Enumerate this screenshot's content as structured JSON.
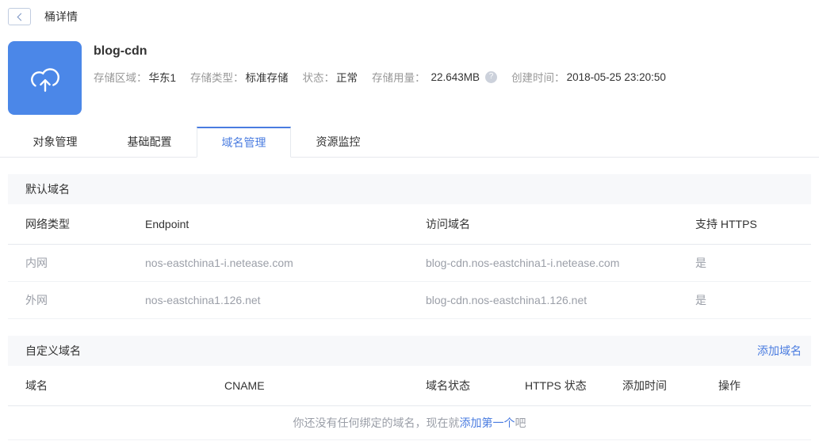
{
  "topbar": {
    "title": "桶详情"
  },
  "bucket": {
    "name": "blog-cdn",
    "meta": [
      {
        "label": "存储区域：",
        "value": "华东1"
      },
      {
        "label": "存储类型：",
        "value": "标准存储"
      },
      {
        "label": "状态：",
        "value": "正常"
      },
      {
        "label": "存储用量：",
        "value": "22.643MB"
      },
      {
        "label": "创建时间：",
        "value": "2018-05-25 23:20:50"
      }
    ]
  },
  "icons": {
    "help": "?"
  },
  "tabs": [
    {
      "label": "对象管理",
      "active": false
    },
    {
      "label": "基础配置",
      "active": false
    },
    {
      "label": "域名管理",
      "active": true
    },
    {
      "label": "资源监控",
      "active": false
    }
  ],
  "default_domain": {
    "section_title": "默认域名",
    "columns": [
      "网络类型",
      "Endpoint",
      "访问域名",
      "支持 HTTPS"
    ],
    "rows": [
      [
        "内网",
        "nos-eastchina1-i.netease.com",
        "blog-cdn.nos-eastchina1-i.netease.com",
        "是"
      ],
      [
        "外网",
        "nos-eastchina1.126.net",
        "blog-cdn.nos-eastchina1.126.net",
        "是"
      ]
    ]
  },
  "custom_domain": {
    "section_title": "自定义域名",
    "add_link": "添加域名",
    "columns": [
      "域名",
      "CNAME",
      "域名状态",
      "HTTPS 状态",
      "添加时间",
      "操作"
    ],
    "empty": {
      "prefix": "你还没有任何绑定的域名，现在就",
      "link": "添加第一个",
      "suffix": "吧"
    }
  },
  "colors": {
    "accent_blue": "#4a7ce0",
    "icon_blue": "#4b87e8",
    "band_bg": "#f7f8fa",
    "muted_text": "#9b9fa8"
  }
}
